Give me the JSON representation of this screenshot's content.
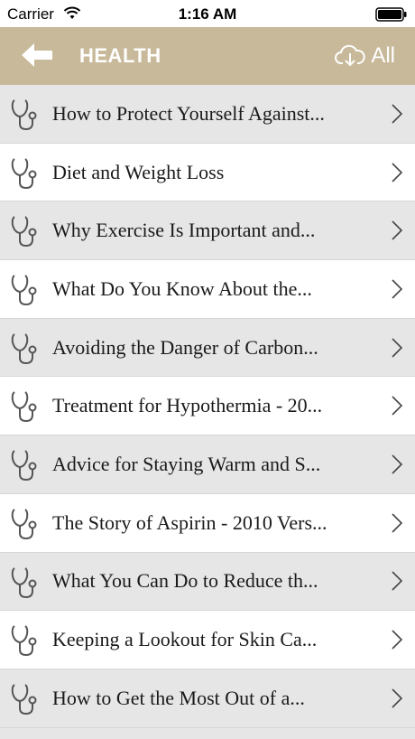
{
  "status_bar": {
    "carrier": "Carrier",
    "time": "1:16 AM",
    "wifi_icon": "wifi-icon",
    "battery_icon": "battery-icon"
  },
  "nav": {
    "title": "HEALTH",
    "back_icon": "back-arrow-icon",
    "download_icon": "cloud-download-icon",
    "all_label": "All",
    "background_color": "#c8b99a"
  },
  "list": {
    "row_icon": "stethoscope-icon",
    "chevron_icon": "chevron-right-icon",
    "shaded_color": "#e6e6e6",
    "items": [
      {
        "label": "How to Protect Yourself Against..."
      },
      {
        "label": "Diet and Weight Loss"
      },
      {
        "label": "Why Exercise Is Important and..."
      },
      {
        "label": "What Do You Know About the..."
      },
      {
        "label": "Avoiding the Danger of Carbon..."
      },
      {
        "label": "Treatment for Hypothermia - 20..."
      },
      {
        "label": "Advice for Staying Warm and S..."
      },
      {
        "label": "The Story of Aspirin - 2010 Vers..."
      },
      {
        "label": "What You Can Do to Reduce th..."
      },
      {
        "label": "Keeping a Lookout for Skin Ca..."
      },
      {
        "label": "How to Get the Most Out of a..."
      }
    ]
  }
}
